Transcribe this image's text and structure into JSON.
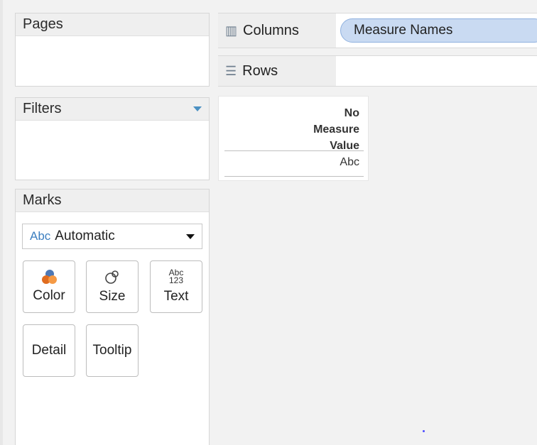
{
  "left_panel": {
    "pages_title": "Pages",
    "filters_title": "Filters",
    "marks_title": "Marks",
    "marks_type_icon": "Abc",
    "marks_type_value": "Automatic",
    "marks_buttons": {
      "color": "Color",
      "size": "Size",
      "text": "Text",
      "text_icon_top": "Abc",
      "text_icon_bottom": "123",
      "detail": "Detail",
      "tooltip": "Tooltip"
    }
  },
  "shelves": {
    "columns_label": "Columns",
    "columns_pill": "Measure Names",
    "rows_label": "Rows"
  },
  "view": {
    "header_line1": "No",
    "header_line2": "Measure",
    "header_line3": "Value",
    "cell_value": "Abc"
  },
  "icons": {
    "columns": "columns-icon",
    "rows": "rows-icon",
    "filters_menu": "chevron-down-icon",
    "marks_dropdown": "caret-down-icon",
    "color": "color-icon",
    "size": "size-icon",
    "text": "text-icon"
  },
  "colors": {
    "pill_fill": "#c9daf2",
    "pill_border": "#8fb1df",
    "filter_arrow": "#4a90c2"
  }
}
